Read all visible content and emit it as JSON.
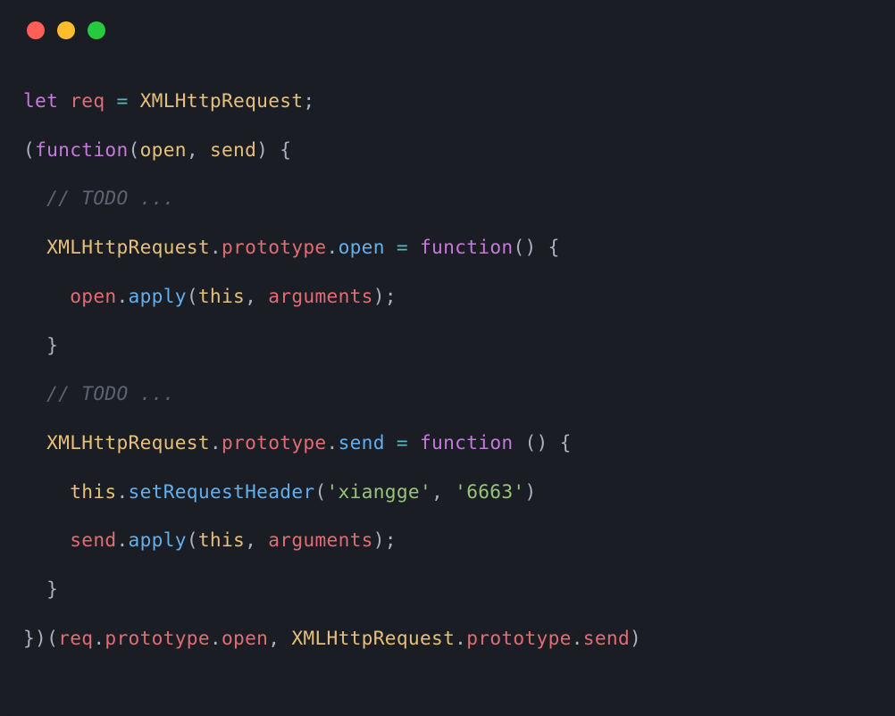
{
  "window": {
    "traffic_lights": [
      "red",
      "yellow",
      "green"
    ]
  },
  "code": {
    "l1": {
      "let": "let",
      "req": "req",
      "eq": "=",
      "XMLHttpRequest": "XMLHttpRequest",
      "semi": ";"
    },
    "l2": {
      "lp": "(",
      "function": "function",
      "lp2": "(",
      "open": "open",
      "comma": ", ",
      "send": "send",
      "rp": ") {"
    },
    "l3": {
      "indent": "  ",
      "comment": "// TODO ..."
    },
    "l4": {
      "indent": "  ",
      "XMLHttpRequest": "XMLHttpRequest",
      "dot": ".",
      "prototype": "prototype",
      "dot2": ".",
      "open": "open",
      "sp_eq": " ",
      "eq": "=",
      "sp2": " ",
      "function": "function",
      "parens": "() {"
    },
    "l5": {
      "indent": "    ",
      "open": "open",
      "dot": ".",
      "apply": "apply",
      "lp": "(",
      "this": "this",
      "comma": ", ",
      "arguments": "arguments",
      "rp": ");"
    },
    "l6": {
      "indent": "  ",
      "rb": "}"
    },
    "l7": {
      "indent": "  ",
      "comment": "// TODO ..."
    },
    "l8": {
      "indent": "  ",
      "XMLHttpRequest": "XMLHttpRequest",
      "dot": ".",
      "prototype": "prototype",
      "dot2": ".",
      "send": "send",
      "sp": " ",
      "eq": "=",
      "sp2": " ",
      "function": "function",
      "parens": " () {"
    },
    "l9": {
      "indent": "    ",
      "this": "this",
      "dot": ".",
      "setRequestHeader": "setRequestHeader",
      "lp": "(",
      "str1": "'xiangge'",
      "comma": ", ",
      "str2": "'6663'",
      "rp": ")"
    },
    "l10": {
      "indent": "    ",
      "send": "send",
      "dot": ".",
      "apply": "apply",
      "lp": "(",
      "this": "this",
      "comma": ", ",
      "arguments": "arguments",
      "rp": ");"
    },
    "l11": {
      "indent": "  ",
      "rb": "}"
    },
    "l12": {
      "rb": "})(",
      "req": "req",
      "dot": ".",
      "prototype": "prototype",
      "dot2": ".",
      "open": "open",
      "comma": ", ",
      "XMLHttpRequest": "XMLHttpRequest",
      "dot3": ".",
      "prototype2": "prototype",
      "dot4": ".",
      "send": "send",
      "rp": ")"
    }
  }
}
